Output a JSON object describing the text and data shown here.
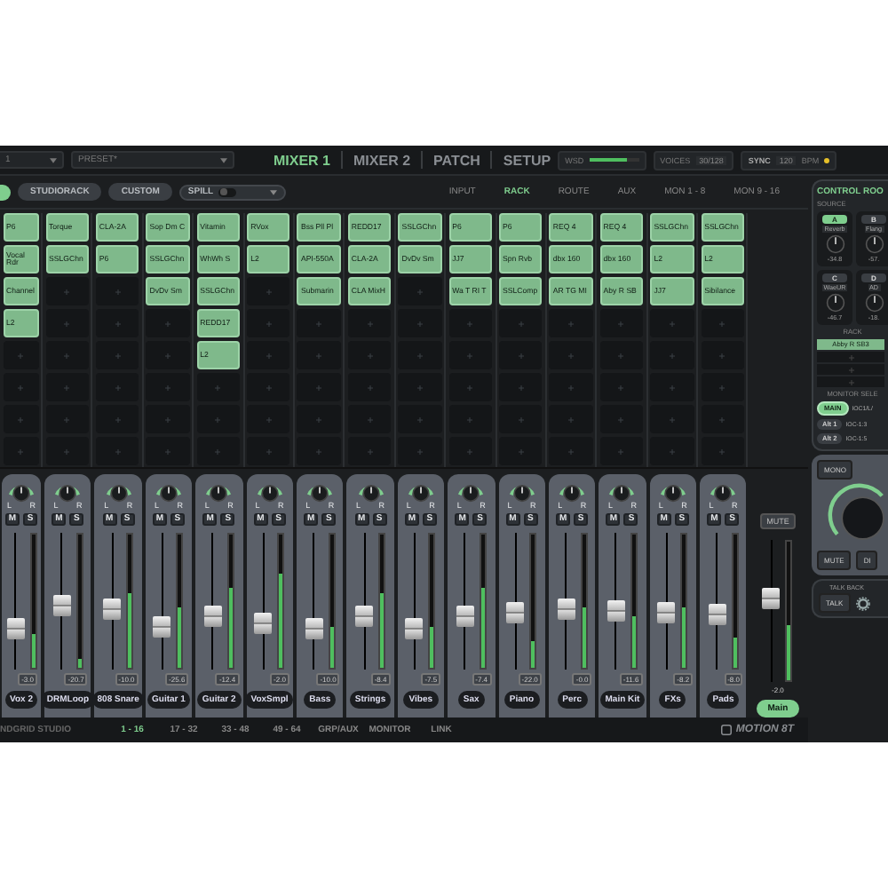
{
  "top_bar": {
    "channel_select": "1",
    "preset": "PRESET*",
    "tabs": [
      {
        "label": "MIXER 1",
        "selected": true
      },
      {
        "label": "MIXER 2",
        "selected": false
      },
      {
        "label": "PATCH",
        "selected": false
      },
      {
        "label": "SETUP",
        "selected": false
      }
    ],
    "wsd": {
      "label": "WSD",
      "level": 0.75
    },
    "voices": {
      "label": "VOICES",
      "value": "30/128"
    },
    "sync": {
      "label": "SYNC",
      "value": "120",
      "unit": "BPM"
    }
  },
  "toolbar": {
    "buttons": [
      "STUDIORACK",
      "CUSTOM"
    ],
    "spill": {
      "label": "SPILL",
      "on": false
    },
    "views": [
      {
        "label": "INPUT",
        "selected": false
      },
      {
        "label": "RACK",
        "selected": true
      },
      {
        "label": "ROUTE",
        "selected": false
      },
      {
        "label": "AUX",
        "selected": false
      },
      {
        "label": "MON 1 - 8",
        "selected": false
      },
      {
        "label": "MON 9 - 16",
        "selected": false
      }
    ]
  },
  "rack": [
    {
      "plugins": [
        "P6",
        "Vocal Rdr",
        "Channel",
        "L2"
      ]
    },
    {
      "plugins": [
        "Torque",
        "SSLGChn"
      ]
    },
    {
      "plugins": [
        "CLA-2A",
        "P6"
      ]
    },
    {
      "plugins": [
        "Sop Dm C",
        "SSLGChn",
        "DvDv Sm"
      ]
    },
    {
      "plugins": [
        "Vitamin",
        "WhWh S",
        "SSLGChn",
        "REDD17",
        "L2"
      ]
    },
    {
      "plugins": [
        "RVox",
        "L2"
      ]
    },
    {
      "plugins": [
        "Bss Pll Pl",
        "API-550A",
        "Submarin"
      ]
    },
    {
      "plugins": [
        "REDD17",
        "CLA-2A",
        "CLA MixH"
      ]
    },
    {
      "plugins": [
        "SSLGChn",
        "DvDv Sm"
      ]
    },
    {
      "plugins": [
        "P6",
        "JJ7",
        "Wa T RI T"
      ]
    },
    {
      "plugins": [
        "P6",
        "Spn Rvb",
        "SSLComp"
      ]
    },
    {
      "plugins": [
        "REQ 4",
        "dbx 160",
        "AR TG MI"
      ]
    },
    {
      "plugins": [
        "REQ 4",
        "dbx 160",
        "Aby R SB"
      ]
    },
    {
      "plugins": [
        "SSLGChn",
        "L2",
        "JJ7"
      ]
    },
    {
      "plugins": [
        "SSLGChn",
        "L2",
        "Sibilance"
      ]
    }
  ],
  "strips": [
    {
      "name": "Vox 2",
      "reading": "-3.0",
      "pan_l": "L",
      "pan_r": "R",
      "mute": "M",
      "solo": "S",
      "fader": {
        "level": 0.25
      },
      "meter": {
        "level": 0.25
      }
    },
    {
      "name": "DRMLoop",
      "reading": "-20.7",
      "pan_l": "L",
      "pan_r": "R",
      "mute": "M",
      "solo": "S",
      "fader": {
        "level": 0.45
      },
      "meter": {
        "level": 0.06
      }
    },
    {
      "name": "808 Snare",
      "reading": "-10.0",
      "pan_l": "L",
      "pan_r": "R",
      "mute": "M",
      "solo": "S",
      "fader": {
        "level": 0.42
      },
      "meter": {
        "level": 0.55
      }
    },
    {
      "name": "Guitar 1",
      "reading": "-25.6",
      "pan_l": "L",
      "pan_r": "R",
      "mute": "M",
      "solo": "S",
      "fader": {
        "level": 0.27
      },
      "meter": {
        "level": 0.45
      }
    },
    {
      "name": "Guitar 2",
      "reading": "-12.4",
      "pan_l": "L",
      "pan_r": "R",
      "mute": "M",
      "solo": "S",
      "fader": {
        "level": 0.36
      },
      "meter": {
        "level": 0.6
      }
    },
    {
      "name": "VoxSmpl",
      "reading": "-2.0",
      "pan_l": "L",
      "pan_r": "R",
      "mute": "M",
      "solo": "S",
      "fader": {
        "level": 0.3
      },
      "meter": {
        "level": 0.7
      }
    },
    {
      "name": "Bass",
      "reading": "-10.0",
      "pan_l": "L",
      "pan_r": "R",
      "mute": "M",
      "solo": "S",
      "fader": {
        "level": 0.26
      },
      "meter": {
        "level": 0.3
      }
    },
    {
      "name": "Strings",
      "reading": "-8.4",
      "pan_l": "L",
      "pan_r": "R",
      "mute": "M",
      "solo": "S",
      "fader": {
        "level": 0.36
      },
      "meter": {
        "level": 0.55
      }
    },
    {
      "name": "Vibes",
      "reading": "-7.5",
      "pan_l": "L",
      "pan_r": "R",
      "mute": "M",
      "solo": "S",
      "fader": {
        "level": 0.26
      },
      "meter": {
        "level": 0.3
      }
    },
    {
      "name": "Sax",
      "reading": "-7.4",
      "pan_l": "L",
      "pan_r": "R",
      "mute": "M",
      "solo": "S",
      "fader": {
        "level": 0.36
      },
      "meter": {
        "level": 0.6
      }
    },
    {
      "name": "Piano",
      "reading": "-22.0",
      "pan_l": "L",
      "pan_r": "R",
      "mute": "M",
      "solo": "S",
      "fader": {
        "level": 0.4
      },
      "meter": {
        "level": 0.2
      }
    },
    {
      "name": "Perc",
      "reading": "-0.0",
      "pan_l": "L",
      "pan_r": "R",
      "mute": "M",
      "solo": "S",
      "fader": {
        "level": 0.42
      },
      "meter": {
        "level": 0.45
      }
    },
    {
      "name": "Main Kit",
      "reading": "-11.6",
      "pan_l": "L",
      "pan_r": "R",
      "mute": "M",
      "solo": "S",
      "fader": {
        "level": 0.41
      },
      "meter": {
        "level": 0.38
      }
    },
    {
      "name": "FXs",
      "reading": "-8.2",
      "pan_l": "L",
      "pan_r": "R",
      "mute": "M",
      "solo": "S",
      "fader": {
        "level": 0.4
      },
      "meter": {
        "level": 0.45
      }
    },
    {
      "name": "Pads",
      "reading": "-8.0",
      "pan_l": "L",
      "pan_r": "R",
      "mute": "M",
      "solo": "S",
      "fader": {
        "level": 0.38
      },
      "meter": {
        "level": 0.22
      }
    }
  ],
  "master": {
    "mute": "MUTE",
    "name": "Main",
    "reading": "-2.0",
    "fader": {
      "level": 0.6
    },
    "meter": {
      "level": 0.4
    }
  },
  "bottom_bar": {
    "brand": "NDGRID STUDIO",
    "banks": [
      {
        "label": "1 - 16",
        "selected": true
      },
      {
        "label": "17 - 32",
        "selected": false
      },
      {
        "label": "33 - 48",
        "selected": false
      },
      {
        "label": "49 - 64",
        "selected": false
      },
      {
        "label": "GRP/AUX",
        "selected": false
      },
      {
        "label": "MONITOR",
        "selected": false
      },
      {
        "label": "LINK",
        "selected": false
      }
    ],
    "logo": "MOTION 8T"
  },
  "control_room": {
    "title": "CONTROL ROO",
    "source_label": "SOURCE",
    "sources": [
      {
        "letter": "A",
        "selected": true,
        "preset": "Reverb",
        "reading": "-34.8"
      },
      {
        "letter": "B",
        "selected": false,
        "preset": "Flang",
        "reading": "-57."
      },
      {
        "letter": "C",
        "selected": false,
        "preset": "WaeUR",
        "reading": "-46.7"
      },
      {
        "letter": "D",
        "selected": false,
        "preset": "AD",
        "reading": "-18."
      }
    ],
    "rack_label": "RACK",
    "rack": [
      "Abby R SB3"
    ],
    "monitor_label": "MONITOR SELE",
    "monitors": [
      {
        "label": "MAIN",
        "selected": true,
        "route": "IOC1/L/"
      },
      {
        "label": "Alt 1",
        "selected": false,
        "route": "IOC-1:3"
      },
      {
        "label": "Alt 2",
        "selected": false,
        "route": "IOC-1:5"
      }
    ],
    "mono": "MONO",
    "mute": "MUTE",
    "dim": "DI",
    "talkback_label": "TALK BACK",
    "talk": "TALK"
  }
}
